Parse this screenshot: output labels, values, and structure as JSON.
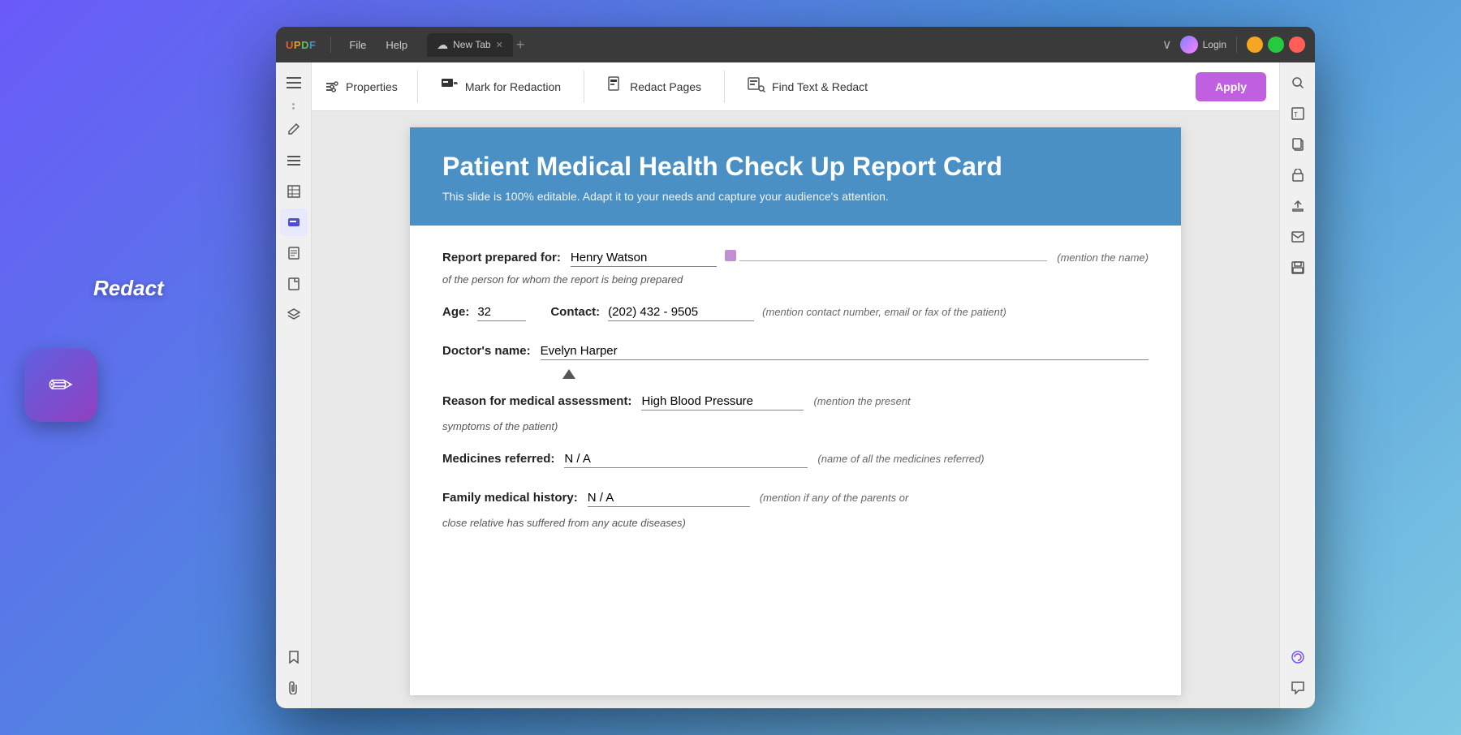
{
  "app": {
    "brand": "UPDF",
    "brand_letters": [
      "U",
      "P",
      "D",
      "F"
    ],
    "brand_colors": [
      "#e06030",
      "#e0a020",
      "#60c060",
      "#4090e0"
    ]
  },
  "titlebar": {
    "menus": [
      "File",
      "Help"
    ],
    "tab_label": "New Tab",
    "login_label": "Login",
    "min_label": "−",
    "max_label": "□",
    "close_label": "✕"
  },
  "toolbar": {
    "properties_label": "Properties",
    "mark_label": "Mark for Redaction",
    "redact_pages_label": "Redact Pages",
    "find_redact_label": "Find Text & Redact",
    "apply_label": "Apply"
  },
  "sidebar_left": {
    "icons": [
      "☰",
      "✏️",
      "📋",
      "📊",
      "🔖",
      "📄",
      "⬛",
      "◻"
    ]
  },
  "sidebar_right": {
    "icons": [
      "🔍",
      "⬛",
      "📋",
      "🔒",
      "📤",
      "✉",
      "💾",
      "✨",
      "💬"
    ]
  },
  "document": {
    "header_title": "Patient Medical Health Check Up Report Card",
    "header_subtitle": "This slide is 100% editable. Adapt it to your needs and capture your audience's attention.",
    "fields": {
      "report_prepared_for_label": "Report prepared for:",
      "report_prepared_for_value": "Henry Watson",
      "report_prepared_for_hint": "(mention the name)",
      "report_of_hint": "of the person for whom the report is being prepared",
      "age_label": "Age:",
      "age_value": "32",
      "contact_label": "Contact:",
      "contact_value": "(202) 432 - 9505",
      "contact_hint": "(mention contact number, email or fax of the patient)",
      "doctors_name_label": "Doctor's name:",
      "doctors_name_value": "Evelyn  Harper",
      "reason_label": "Reason for medical assessment:",
      "reason_value": "High Blood Pressure",
      "reason_hint": "(mention the present",
      "symptoms_hint": "symptoms of the patient)",
      "medicines_label": "Medicines referred:",
      "medicines_value": "N / A",
      "medicines_hint": "(name of all the medicines referred)",
      "family_history_label": "Family medical history:",
      "family_history_value": "N / A",
      "family_history_hint": "(mention if any of the parents or",
      "family_history_hint2": "close relative has suffered from any acute diseases)"
    }
  },
  "redact_label": "Redact"
}
